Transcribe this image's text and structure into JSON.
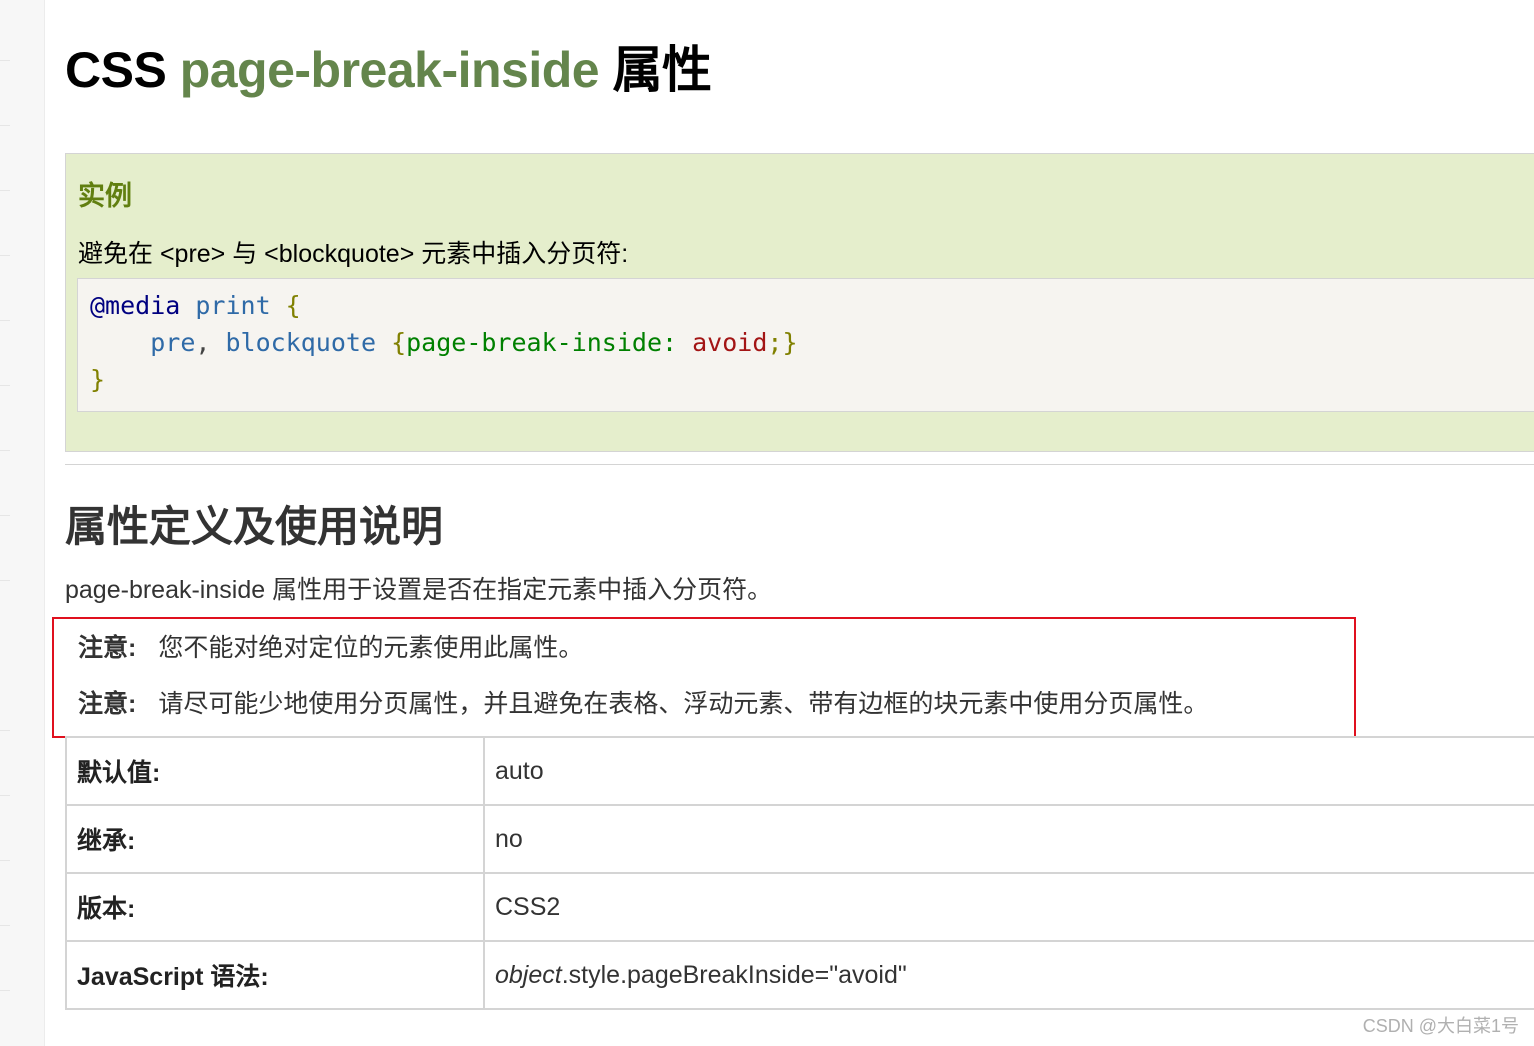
{
  "title": {
    "prefix": "CSS ",
    "highlight": "page-break-inside",
    "suffix": " 属性"
  },
  "example": {
    "heading": "实例",
    "description": "避免在 <pre> 与 <blockquote> 元素中插入分页符:",
    "code": {
      "line1": {
        "at": "@media",
        "kw": " print",
        "brace": " {"
      },
      "line2": {
        "indent": "    ",
        "sel1": "pre",
        "comma": ",",
        "sel2": " blockquote",
        "open": " {",
        "prop": "page-break-inside:",
        "val": " avoid",
        "semi": ";",
        "close": "}"
      },
      "line3": {
        "brace": "}"
      }
    }
  },
  "section": {
    "title": "属性定义及使用说明",
    "definition": "page-break-inside 属性用于设置是否在指定元素中插入分页符。"
  },
  "notes": [
    {
      "label": "注意:",
      "text": "您不能对绝对定位的元素使用此属性。"
    },
    {
      "label": "注意:",
      "text": "请尽可能少地使用分页属性，并且避免在表格、浮动元素、带有边框的块元素中使用分页属性。"
    }
  ],
  "properties": [
    {
      "key": "默认值:",
      "value": "auto"
    },
    {
      "key": "继承:",
      "value": "no"
    },
    {
      "key": "版本:",
      "value": "CSS2"
    },
    {
      "key": "JavaScript 语法:",
      "value_italic": "object",
      "value": ".style.pageBreakInside=\"avoid\""
    }
  ],
  "watermark": "CSDN @大白菜1号",
  "colors": {
    "title_green": "#64854c",
    "example_bg": "#e5eecc",
    "example_heading": "#617f10",
    "highlight_border": "#e0101e"
  }
}
